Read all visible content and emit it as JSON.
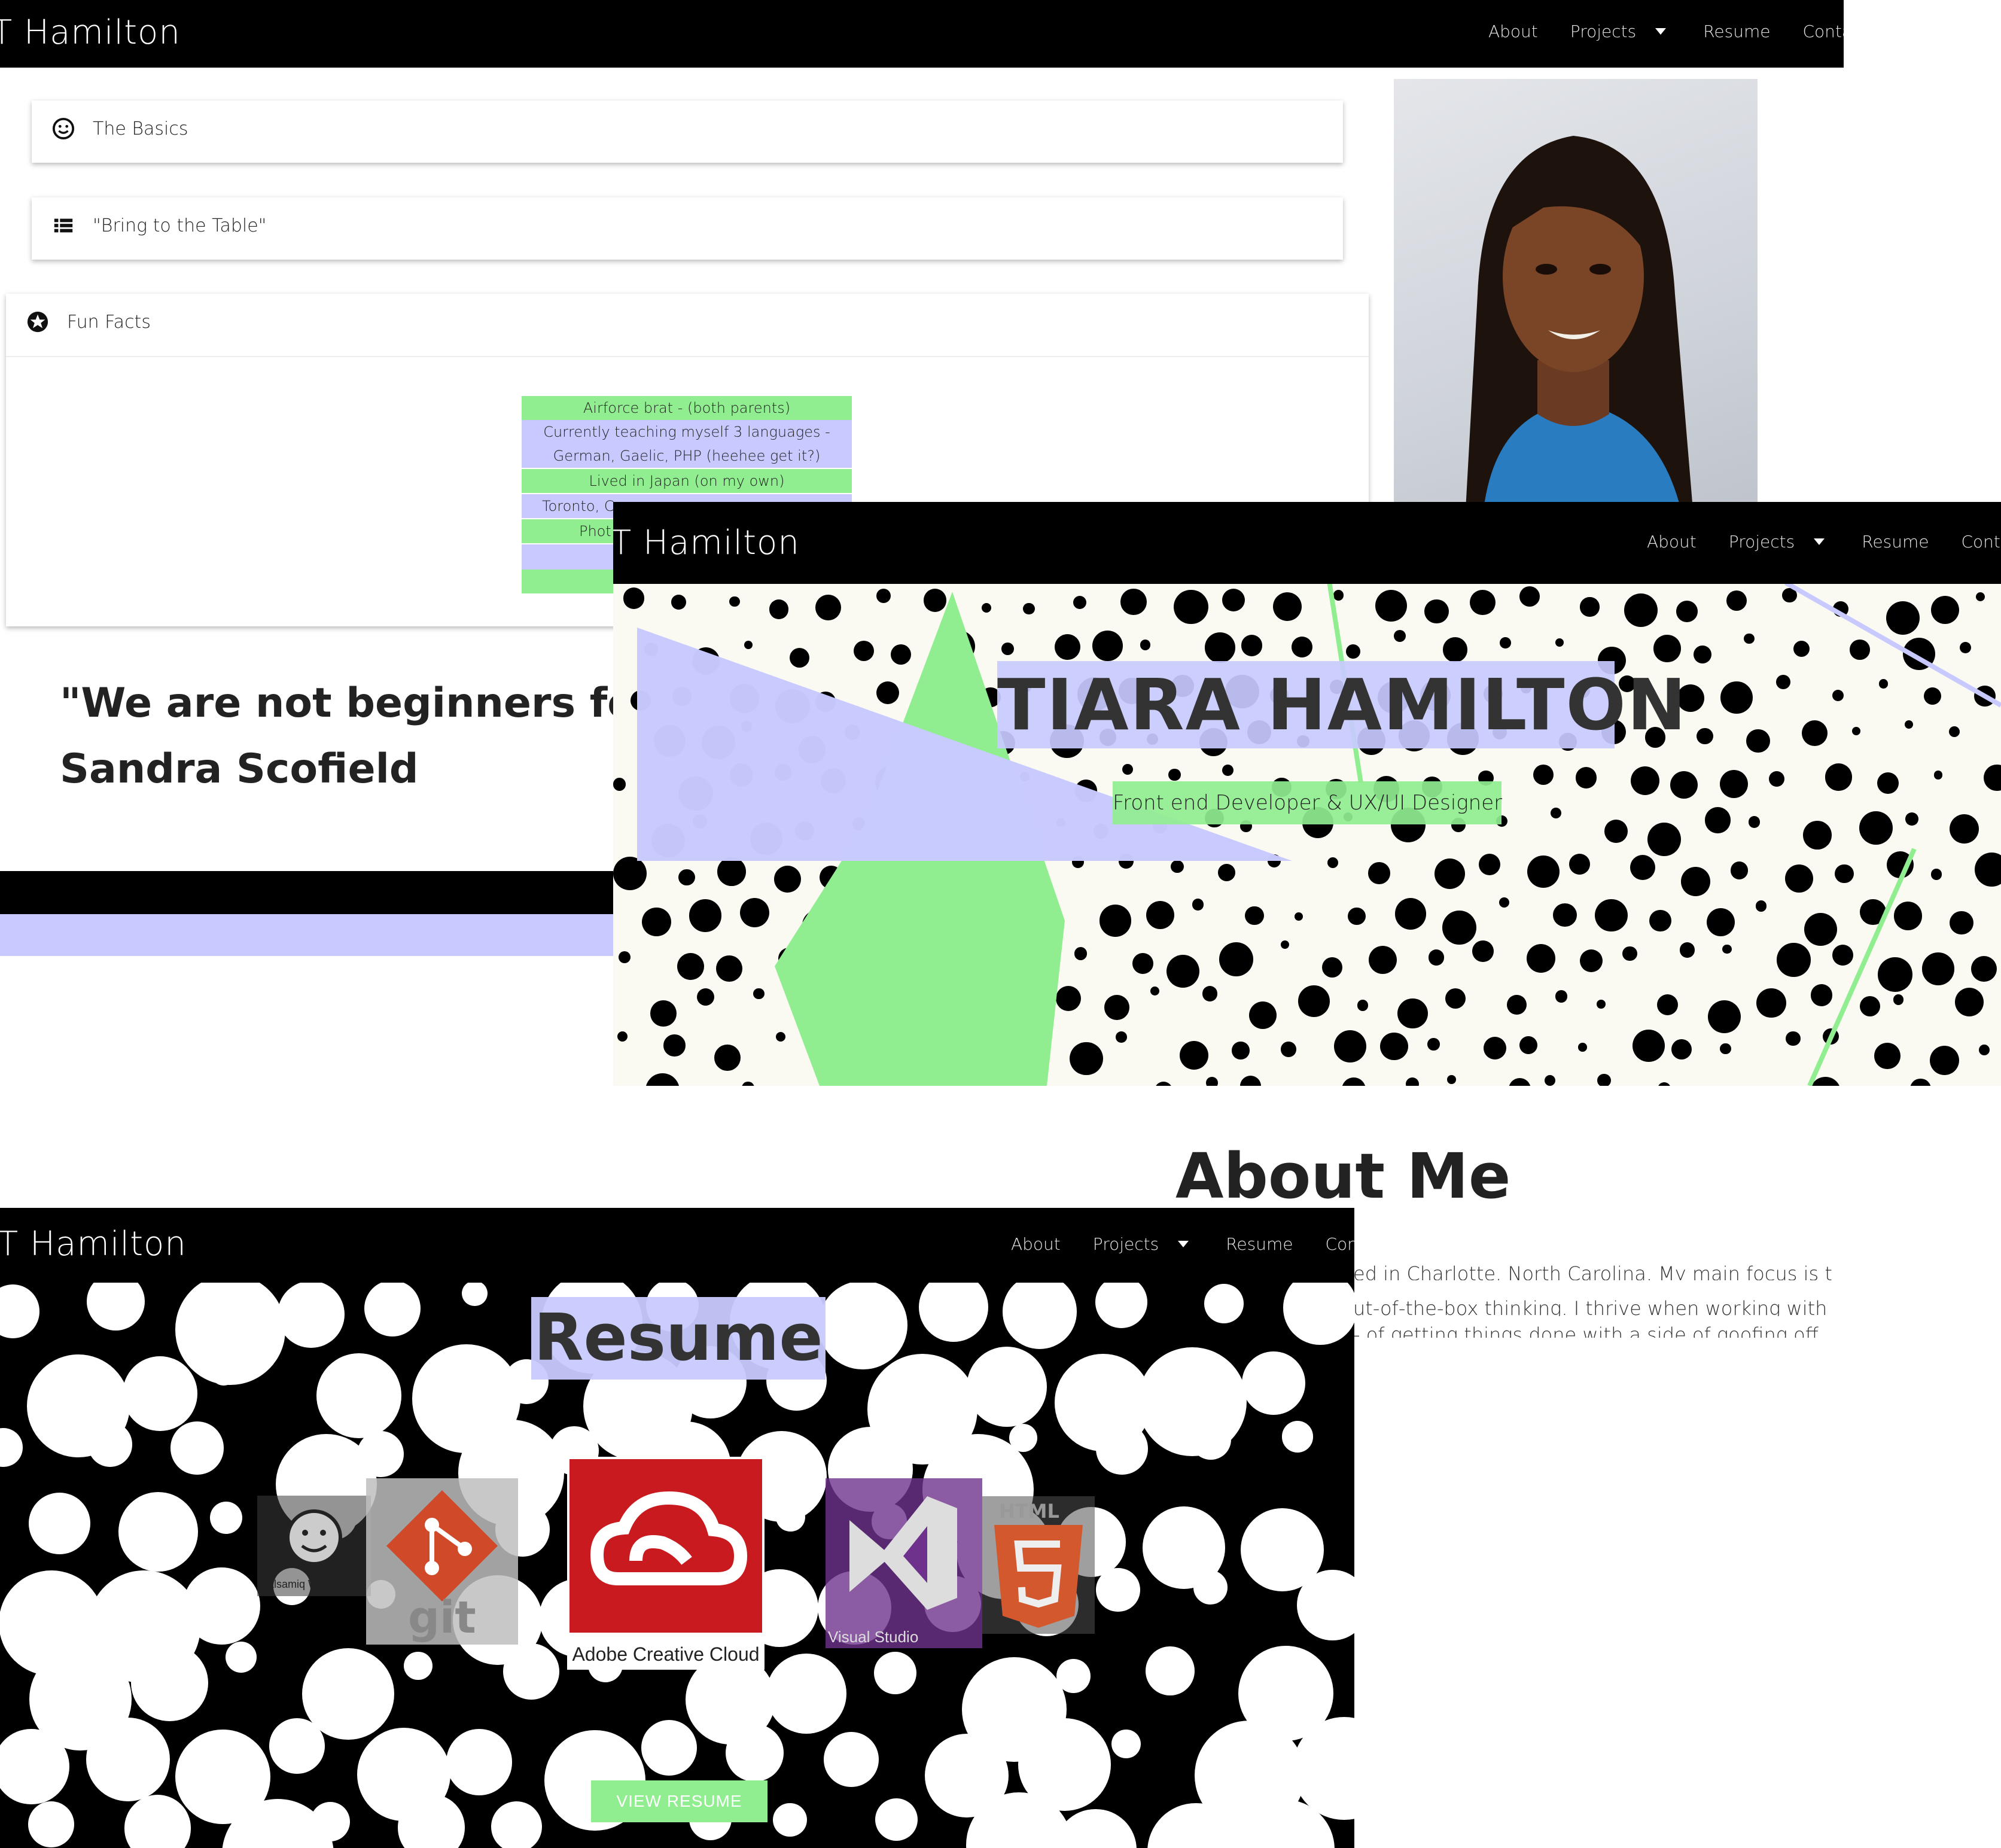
{
  "nav": {
    "brand": "T Hamilton",
    "links": [
      "About",
      "Projects",
      "Resume",
      "Contact"
    ]
  },
  "about_section": {
    "accordion": [
      {
        "label": "The Basics",
        "icon": "smile-icon"
      },
      {
        "label": "\"Bring to the Table\"",
        "icon": "list-icon"
      },
      {
        "label": "Fun Facts",
        "icon": "star-icon"
      }
    ],
    "fun_facts": [
      "Airforce brat - (both parents)",
      "Currently teaching myself 3 languages -",
      "German, Gaelic, PHP (heehee get it?)",
      "Lived in Japan (on my own)",
      "Toronto, C",
      "Phot"
    ],
    "quote_line1": "\"We are not beginners fore",
    "quote_line2": "Sandra Scofield"
  },
  "hero": {
    "title": "TIARA HAMILTON",
    "subtitle": "Front end Developer & UX/UI Designer"
  },
  "about_me": {
    "title": "About Me",
    "lines": [
      "ed in Charlotte, North Carolina. My main focus is to",
      "ut-of-the-box thinking. I thrive when working with",
      "- of getting things done with a side of goofing off"
    ]
  },
  "resume": {
    "title": "Resume",
    "tools": [
      {
        "label": "balsamiq Wireframes",
        "icon": "balsamiq-icon"
      },
      {
        "label": "git",
        "icon": "git-icon"
      },
      {
        "label": "Adobe Creative Cloud",
        "icon": "adobe-creative-cloud-icon"
      },
      {
        "label": "Visual Studio",
        "icon": "visual-studio-icon"
      },
      {
        "label": "HTML",
        "icon": "html5-icon"
      }
    ],
    "button": "VIEW RESUME"
  },
  "colors": {
    "lavender": "#c8caff",
    "green": "#90ee90",
    "black": "#000000"
  }
}
